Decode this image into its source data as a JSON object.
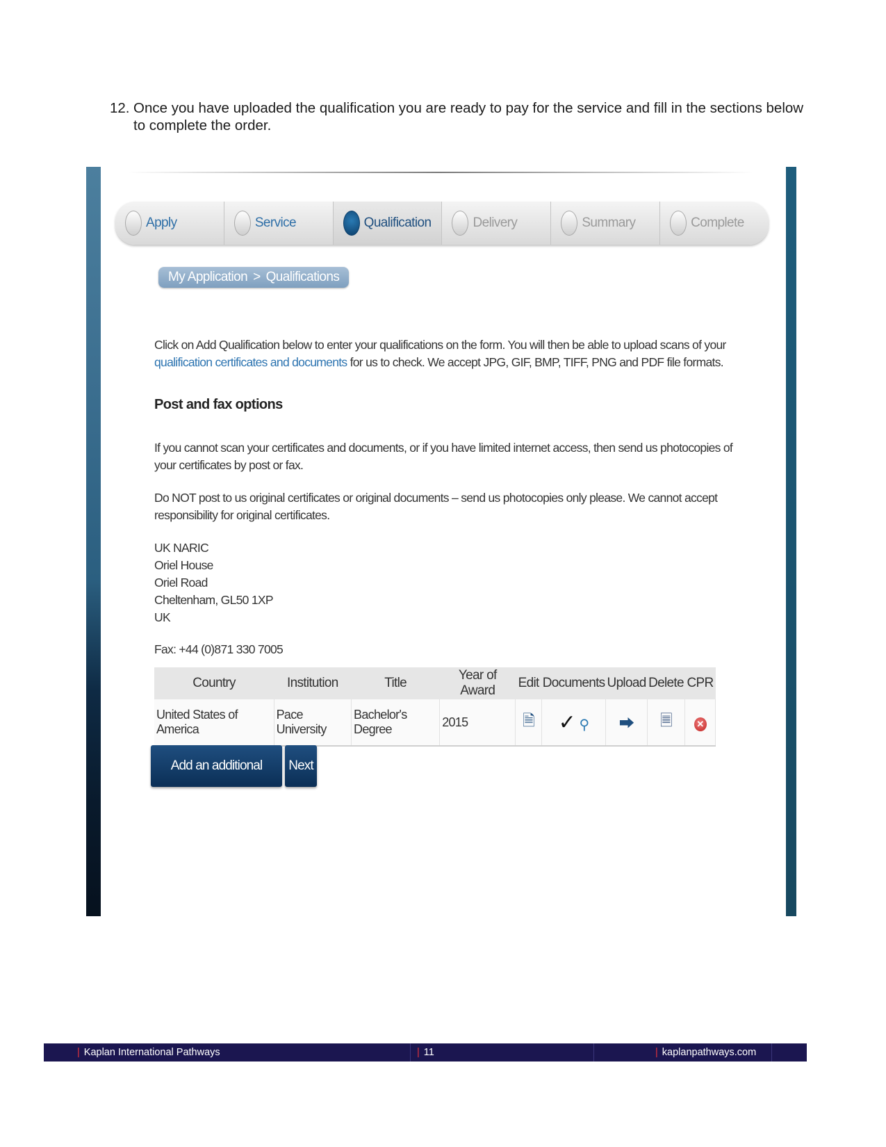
{
  "instruction": {
    "number": "12.",
    "text": "Once you have uploaded the qualification you are ready to pay for the service and fill in the sections below to complete the order."
  },
  "steps": [
    {
      "label": "Apply",
      "state": "done"
    },
    {
      "label": "Service",
      "state": "done"
    },
    {
      "label": "Qualification",
      "state": "current"
    },
    {
      "label": "Delivery",
      "state": "pending"
    },
    {
      "label": "Summary",
      "state": "pending"
    },
    {
      "label": "Complete",
      "state": "pending"
    }
  ],
  "breadcrumb": {
    "root": "My Application",
    "separator": ">",
    "current": "Qualifications"
  },
  "intro": {
    "text_before": "Click on Add Qualification below to enter your qualifications on the form. You will then be able to upload scans of your ",
    "link": "qualification certificates and documents",
    "text_after": " for us to check. We accept JPG, GIF, BMP, TIFF, PNG and PDF file formats."
  },
  "post_fax": {
    "heading": "Post and fax options",
    "paragraph1": "If you cannot scan your certificates and documents, or if you have limited internet access, then send us photocopies of your certificates by post or fax.",
    "paragraph2": "Do NOT post to us original certificates or original documents – send us photocopies only please. We cannot accept responsibility for original certificates.",
    "address": [
      "UK NARIC",
      "Oriel House",
      "Oriel Road",
      "Cheltenham, GL50 1XP",
      "UK"
    ],
    "fax": "Fax: +44 (0)871 330 7005"
  },
  "table": {
    "headers": {
      "country": "Country",
      "institution": "Institution",
      "title": "Title",
      "year": "Year of Award",
      "edit": "Edit",
      "documents": "Documents",
      "upload": "Upload",
      "delete": "Delete",
      "cpr": "CPR"
    },
    "rows": [
      {
        "country": "United States of America",
        "institution": "Pace University",
        "title": "Bachelor's Degree",
        "year": "2015",
        "edit_icon": "edit-document-icon",
        "documents_icons": [
          "checkmark-icon",
          "magnifier-icon"
        ],
        "upload_icon": "upload-arrow-icon",
        "delete_icon": "delete-document-icon",
        "cpr_icon": "red-x-icon"
      }
    ]
  },
  "buttons": {
    "add": "Add an additional qualification",
    "next": "Next"
  },
  "footer": {
    "left": "Kaplan International Pathways",
    "page": "11",
    "right": "kaplanpathways.com"
  },
  "colors": {
    "footer_bg": "#1b1650",
    "footer_accent": "#e5333b",
    "button_bg": "#0b2f56",
    "link": "#2b73b0",
    "step_current": "#1f4f7f"
  }
}
